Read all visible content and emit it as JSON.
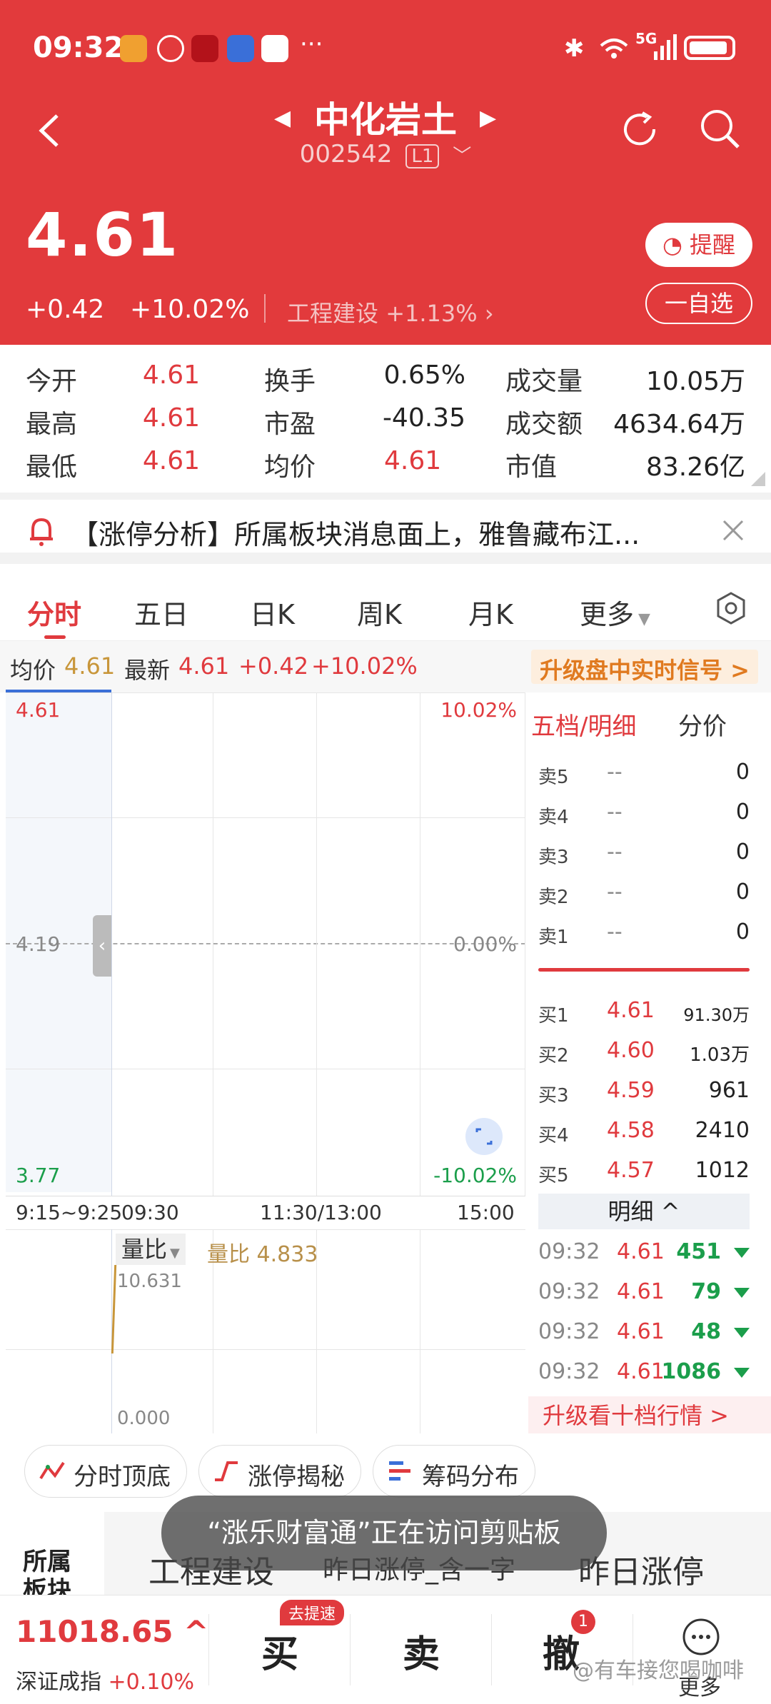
{
  "status_bar": {
    "time": "09:32",
    "network": "5G"
  },
  "header": {
    "stock_name": "中化岩土",
    "stock_code": "002542",
    "level": "L1"
  },
  "quote": {
    "price": "4.61",
    "change": "+0.42",
    "change_pct": "+10.02%",
    "sector": "工程建设",
    "sector_pct": "+1.13%",
    "remind_label": "提醒",
    "watch_label": "一自选"
  },
  "stats": [
    {
      "l1": "今开",
      "v1": "4.61",
      "l2": "换手",
      "v2": "0.65%",
      "l3": "成交量",
      "v3": "10.05万"
    },
    {
      "l1": "最高",
      "v1": "4.61",
      "l2": "市盈",
      "v2": "-40.35",
      "l3": "成交额",
      "v3": "4634.64万"
    },
    {
      "l1": "最低",
      "v1": "4.61",
      "l2": "均价",
      "v2": "4.61",
      "l3": "市值",
      "v3": "83.26亿"
    }
  ],
  "notice": {
    "text": "【涨停分析】所属板块消息面上，雅鲁藏布江..."
  },
  "tabs": [
    "分时",
    "五日",
    "日K",
    "周K",
    "月K",
    "更多"
  ],
  "info_line": {
    "avg_label": "均价",
    "avg_value": "4.61",
    "latest_label": "最新",
    "latest_value": "4.61",
    "change": "+0.42",
    "change_pct": "+10.02%",
    "upgrade_text": "升级盘中实时信号 >"
  },
  "chart": {
    "y_top": "4.61",
    "y_mid": "4.19",
    "y_bot": "3.77",
    "pct_top": "10.02%",
    "pct_mid": "0.00%",
    "pct_bot": "-10.02%",
    "x_labels": [
      "9:15~9:25",
      "09:30",
      "11:30/13:00",
      "15:00"
    ],
    "vol_selector": "量比",
    "vol_label": "量比 4.833",
    "vol_top": "10.631",
    "vol_bot": "0.000"
  },
  "orderbook": {
    "title": "五档/明细",
    "title2": "分价",
    "sells": [
      {
        "label": "卖5",
        "price": "--",
        "vol": "0"
      },
      {
        "label": "卖4",
        "price": "--",
        "vol": "0"
      },
      {
        "label": "卖3",
        "price": "--",
        "vol": "0"
      },
      {
        "label": "卖2",
        "price": "--",
        "vol": "0"
      },
      {
        "label": "卖1",
        "price": "--",
        "vol": "0"
      }
    ],
    "buys": [
      {
        "label": "买1",
        "price": "4.61",
        "vol": "91.30万"
      },
      {
        "label": "买2",
        "price": "4.60",
        "vol": "1.03万"
      },
      {
        "label": "买3",
        "price": "4.59",
        "vol": "961"
      },
      {
        "label": "买4",
        "price": "4.58",
        "vol": "2410"
      },
      {
        "label": "买5",
        "price": "4.57",
        "vol": "1012"
      }
    ],
    "detail_label": "明细 ^",
    "trades": [
      {
        "time": "09:32",
        "price": "4.61",
        "vol": "451"
      },
      {
        "time": "09:32",
        "price": "4.61",
        "vol": "79"
      },
      {
        "time": "09:32",
        "price": "4.61",
        "vol": "48"
      },
      {
        "time": "09:32",
        "price": "4.61",
        "vol": "1086"
      }
    ],
    "upgrade_text": "升级看十档行情 >"
  },
  "chips": [
    "分时顶底",
    "涨停揭秘",
    "筹码分布"
  ],
  "toast": "“涨乐财富通”正在访问剪贴板",
  "sectors_row": {
    "label": "所属板块",
    "item1": "工程建设",
    "item2": "昨日涨停_含一字",
    "item3": "昨日涨停"
  },
  "bottom_bar": {
    "index_value": "11018.65 ^",
    "index_name": "深证成指",
    "index_pct": "+0.10%",
    "buy": "买",
    "buy_badge": "去提速",
    "sell": "卖",
    "cancel": "撤",
    "cancel_badge": "1",
    "more": "更多"
  },
  "watermark": "@有车接您喝咖啡"
}
